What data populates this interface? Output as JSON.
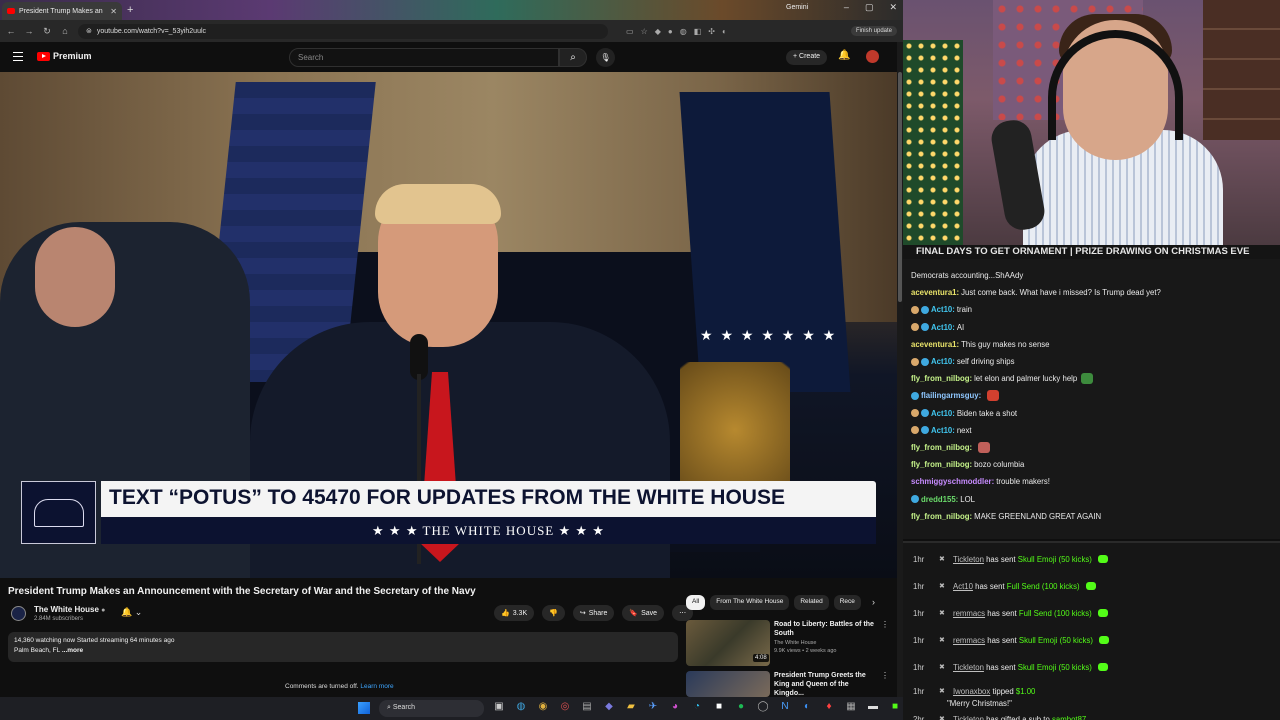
{
  "browser": {
    "tab_title": "President Trump Makes an",
    "gemini_label": "Gemini",
    "url": "youtube.com/watch?v=_53yih2uulc",
    "finish_update": "Finish update"
  },
  "youtube": {
    "logo_text": "Premium",
    "search_placeholder": "Search",
    "create_label": "Create"
  },
  "video": {
    "lower_third_headline": "TEXT “POTUS” TO 45470 FOR UPDATES FROM THE WHITE HOUSE",
    "lower_third_sub": "★ ★ ★  THE WHITE HOUSE  ★ ★ ★",
    "title": "President Trump Makes an Announcement with the Secretary of War and the Secretary of the Navy",
    "channel_name": "The White House",
    "subscribers": "2.84M subscribers",
    "likes": "3.3K",
    "share_label": "Share",
    "save_label": "Save",
    "more_label": "⋯",
    "description_line1": "14,360 watching now  Started streaming 64 minutes ago",
    "description_line2": "Palm Beach, FL",
    "description_more": "...more",
    "comments_off": "Comments are turned off.",
    "learn_more": "Learn more"
  },
  "chips": [
    "All",
    "From The White House",
    "Related",
    "Rece"
  ],
  "recommendations": [
    {
      "title": "Road to Liberty: Battles of the South",
      "channel": "The White House",
      "meta": "9.9K views • 2 weeks ago",
      "duration": "4:08"
    },
    {
      "title": "President Trump Greets the King and Queen of the Kingdo...",
      "channel": "",
      "meta": "",
      "duration": ""
    }
  ],
  "taskbar": {
    "search_label": "Search"
  },
  "stream": {
    "ticker": "FINAL DAYS TO GET ORNAMENT | PRIZE DRAWING ON CHRISTMAS EVE",
    "chat": [
      {
        "user": "",
        "text": "Democrats accounting...ShAAdy",
        "color": "#ffffff",
        "badges": 0,
        "emote": ""
      },
      {
        "user": "aceventura1:",
        "text": "Just come back. What have i missed? Is Trump dead yet?",
        "color": "#e9e36a",
        "badges": 0,
        "emote": ""
      },
      {
        "user": "Act10:",
        "text": "train",
        "color": "#41c7f0",
        "badges": 2,
        "emote": ""
      },
      {
        "user": "Act10:",
        "text": "AI",
        "color": "#41c7f0",
        "badges": 2,
        "emote": ""
      },
      {
        "user": "aceventura1:",
        "text": "This guy makes no sense",
        "color": "#e9e36a",
        "badges": 0,
        "emote": ""
      },
      {
        "user": "Act10:",
        "text": "self driving ships",
        "color": "#41c7f0",
        "badges": 2,
        "emote": ""
      },
      {
        "user": "fly_from_nilbog:",
        "text": "let elon and palmer lucky help",
        "color": "#c6f48a",
        "badges": 0,
        "emote": "#3d8b3d"
      },
      {
        "user": "flailingarmsguy:",
        "text": "",
        "color": "#8fc7ff",
        "badges": 1,
        "emote": "#d2402f"
      },
      {
        "user": "Act10:",
        "text": "Biden take a shot",
        "color": "#41c7f0",
        "badges": 2,
        "emote": ""
      },
      {
        "user": "Act10:",
        "text": "next",
        "color": "#41c7f0",
        "badges": 2,
        "emote": ""
      },
      {
        "user": "fly_from_nilbog:",
        "text": "",
        "color": "#c6f48a",
        "badges": 0,
        "emote": "#c0605a"
      },
      {
        "user": "fly_from_nilbog:",
        "text": "bozo columbia",
        "color": "#c6f48a",
        "badges": 0,
        "emote": ""
      },
      {
        "user": "schmiggyschmoddler:",
        "text": "trouble makers!",
        "color": "#c78bff",
        "badges": 0,
        "emote": ""
      },
      {
        "user": "dredd155:",
        "text": "LOL",
        "color": "#6bdc6b",
        "badges": 1,
        "emote": ""
      },
      {
        "user": "fly_from_nilbog:",
        "text": "MAKE GREENLAND GREAT AGAIN",
        "color": "#c6f48a",
        "badges": 0,
        "emote": ""
      }
    ],
    "events": [
      {
        "time": "1hr",
        "user": "Tickleton",
        "action": "has sent",
        "gift": "Skull Emoji (50 kicks)",
        "sub": ""
      },
      {
        "time": "1hr",
        "user": "Act10",
        "action": "has sent",
        "gift": "Full Send (100 kicks)",
        "sub": ""
      },
      {
        "time": "1hr",
        "user": "remmacs",
        "action": "has sent",
        "gift": "Full Send (100 kicks)",
        "sub": ""
      },
      {
        "time": "1hr",
        "user": "remmacs",
        "action": "has sent",
        "gift": "Skull Emoji (50 kicks)",
        "sub": ""
      },
      {
        "time": "1hr",
        "user": "Tickleton",
        "action": "has sent",
        "gift": "Skull Emoji (50 kicks)",
        "sub": ""
      },
      {
        "time": "1hr",
        "user": "Iwonaxbox",
        "action": "tipped",
        "gift": "$1.00",
        "sub": "\"Merry Christmas!\""
      },
      {
        "time": "2hr",
        "user": "Tickleton",
        "action": "has gifted a sub to",
        "gift": "sambot87.",
        "sub": ""
      }
    ]
  }
}
